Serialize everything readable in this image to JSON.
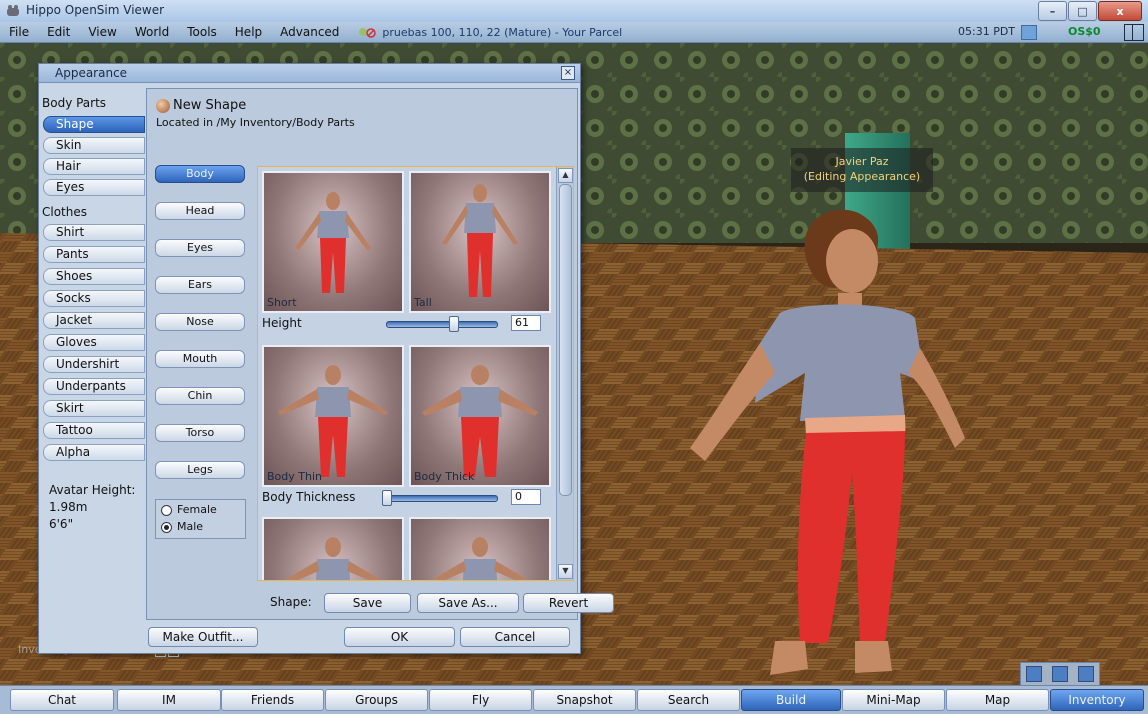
{
  "window": {
    "title": "Hippo OpenSim Viewer",
    "controls": {
      "minimize": "–",
      "maximize": "□",
      "close": "x"
    }
  },
  "menubar": {
    "items": [
      "File",
      "Edit",
      "View",
      "World",
      "Tools",
      "Help",
      "Advanced"
    ],
    "parcel_info": "pruebas 100, 110, 22 (Mature) - Your Parcel",
    "clock": "05:31 PDT",
    "balance": "OS$0"
  },
  "world": {
    "avatar_name": "Javier Paz",
    "avatar_status": "(Editing Appearance)",
    "inventory_ghost": "Inventory"
  },
  "appearance": {
    "title": "Appearance",
    "close_glyph": "×",
    "body_parts_header": "Body Parts",
    "body_parts": [
      "Shape",
      "Skin",
      "Hair",
      "Eyes"
    ],
    "clothes_header": "Clothes",
    "clothes": [
      "Shirt",
      "Pants",
      "Shoes",
      "Socks",
      "Jacket",
      "Gloves",
      "Undershirt",
      "Underpants",
      "Skirt",
      "Tattoo",
      "Alpha"
    ],
    "active_tab": "Shape",
    "avatar_height_label": "Avatar Height:",
    "avatar_height_m": "1.98m",
    "avatar_height_ft": "6'6\"",
    "shape_name": "New Shape",
    "shape_location": "Located in /My Inventory/Body Parts",
    "parts": [
      "Body",
      "Head",
      "Eyes",
      "Ears",
      "Nose",
      "Mouth",
      "Chin",
      "Torso",
      "Legs"
    ],
    "active_part": "Body",
    "sex": {
      "female": "Female",
      "male": "Male",
      "selected": "Male"
    },
    "params": [
      {
        "label": "Height",
        "low": "Short",
        "high": "Tall",
        "value": "61"
      },
      {
        "label": "Body Thickness",
        "low": "Body Thin",
        "high": "Body Thick",
        "value": "0"
      }
    ],
    "shape_row_label": "Shape:",
    "buttons": {
      "save": "Save",
      "save_as": "Save As...",
      "revert": "Revert",
      "make_outfit": "Make Outfit...",
      "ok": "OK",
      "cancel": "Cancel"
    }
  },
  "bottombar": {
    "buttons": [
      "Chat",
      "IM",
      "Friends",
      "Groups",
      "Fly",
      "Snapshot",
      "Search",
      "Build",
      "Mini-Map",
      "Map",
      "Inventory"
    ],
    "active": [
      "Build",
      "Inventory"
    ]
  },
  "colors": {
    "accent": "#2f66bb",
    "balance": "#0a8a2a",
    "nametag": "#f4d27b"
  }
}
